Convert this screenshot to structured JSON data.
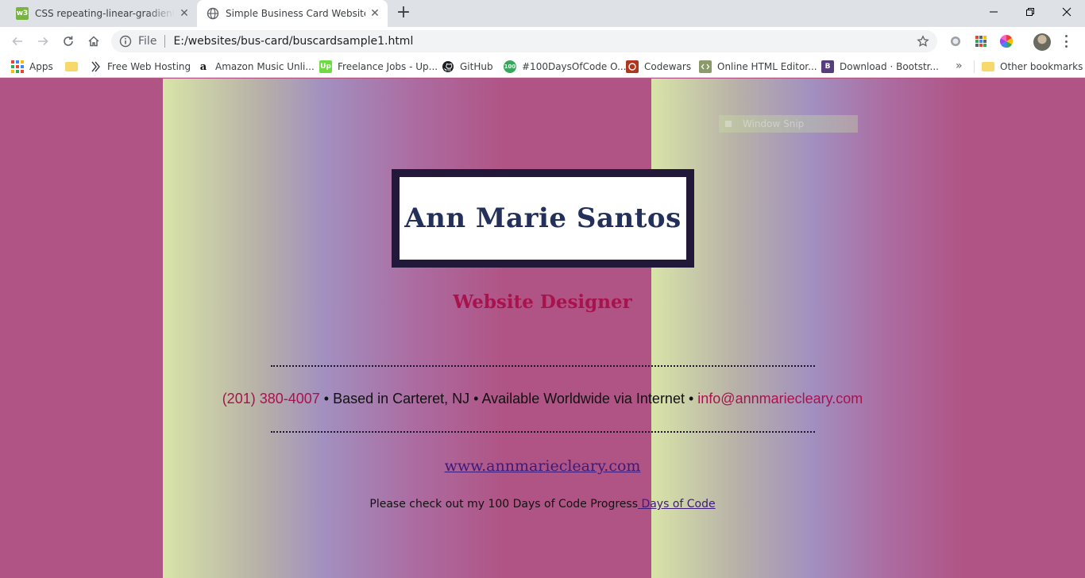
{
  "browser": {
    "tabs": [
      {
        "title": "CSS repeating-linear-gradient() function",
        "favicon": "w3schools-icon",
        "active": false
      },
      {
        "title": "Simple Business Card Website",
        "favicon": "globe-icon",
        "active": true
      }
    ],
    "favicon_w3": "w3",
    "address": {
      "prefix": "File",
      "url": "E:/websites/bus-card/buscardsample1.html"
    },
    "bookmarks": [
      {
        "label": "Apps",
        "icon": "apps-grid-icon"
      },
      {
        "label": "",
        "icon": "folder-icon"
      },
      {
        "label": "Free Web Hosting",
        "icon": "hosting-icon"
      },
      {
        "label": "Amazon Music Unli...",
        "icon": "amazon-icon"
      },
      {
        "label": "Freelance Jobs - Up...",
        "icon": "upwork-icon"
      },
      {
        "label": "GitHub",
        "icon": "github-icon"
      },
      {
        "label": "#100DaysOfCode O...",
        "icon": "100days-icon"
      },
      {
        "label": "Codewars",
        "icon": "codewars-icon"
      },
      {
        "label": "Online HTML Editor...",
        "icon": "html-editor-icon"
      },
      {
        "label": "Download · Bootstr...",
        "icon": "bootstrap-icon"
      }
    ],
    "other_bookmarks": "Other bookmarks",
    "more_chevron": "»",
    "icon_text": {
      "upwork": "Up",
      "days": "100",
      "bootstrap": "B",
      "amazon": "a"
    }
  },
  "overlay": {
    "snip_label": "Window Snip"
  },
  "card": {
    "name": "Ann Marie Santos",
    "job_title": "Website Designer",
    "contact": {
      "phone": "(201) 380-4007",
      "sep1": " • ",
      "location": "Based in Carteret, NJ",
      "sep2": " • ",
      "availability": "Available Worldwide via Internet",
      "sep3": " • ",
      "email": "info@annmariecleary.com"
    },
    "website": "www.annmariecleary.com",
    "progress_text": "Please check out my 100 Days of Code Progress",
    "progress_link": " Days of Code"
  },
  "colors": {
    "background": "#b05485",
    "accent": "#a8124d",
    "name_box": "#22183a",
    "link": "#3d1a78"
  }
}
